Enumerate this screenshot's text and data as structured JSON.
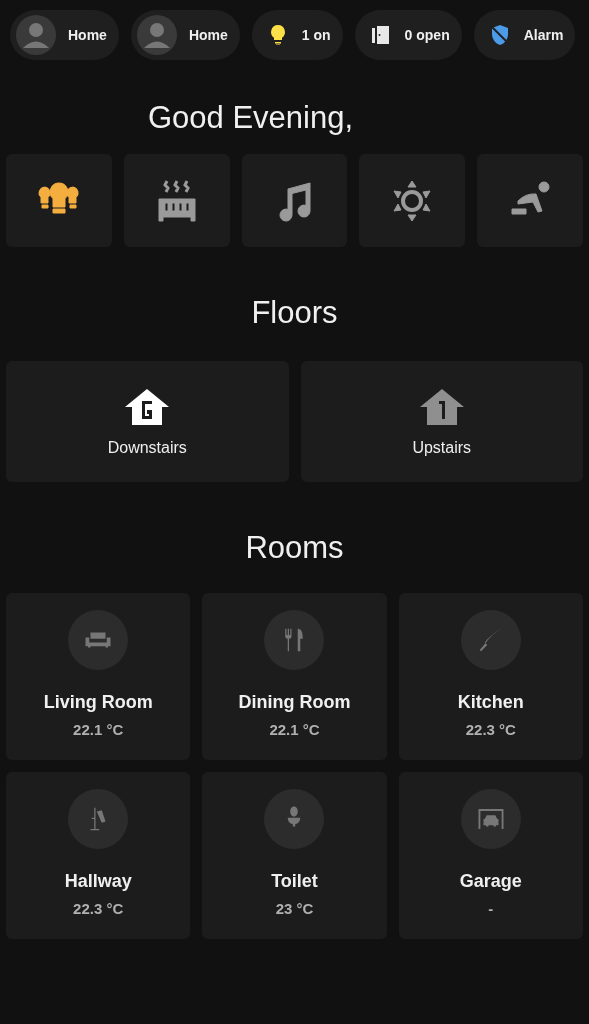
{
  "chips": [
    {
      "kind": "person",
      "label": "Home"
    },
    {
      "kind": "person",
      "label": "Home"
    },
    {
      "kind": "lights",
      "label": "1 on"
    },
    {
      "kind": "doors",
      "label": "0 open"
    },
    {
      "kind": "alarm",
      "label": "Alarm"
    }
  ],
  "greeting": "Good Evening,",
  "quick_actions": [
    {
      "kind": "lights",
      "on": true
    },
    {
      "kind": "heater",
      "on": false
    },
    {
      "kind": "music",
      "on": false
    },
    {
      "kind": "brightness",
      "on": false
    },
    {
      "kind": "vacuum",
      "on": false
    }
  ],
  "floors": {
    "title": "Floors",
    "items": [
      {
        "kind": "ground",
        "label": "Downstairs",
        "active": true
      },
      {
        "kind": "first",
        "label": "Upstairs",
        "active": false
      }
    ]
  },
  "rooms": {
    "title": "Rooms",
    "items": [
      {
        "kind": "sofa",
        "name": "Living Room",
        "temperature": "22.1 °C"
      },
      {
        "kind": "cutlery",
        "name": "Dining Room",
        "temperature": "22.1 °C"
      },
      {
        "kind": "knife",
        "name": "Kitchen",
        "temperature": "22.3 °C"
      },
      {
        "kind": "coat-rack",
        "name": "Hallway",
        "temperature": "22.3 °C"
      },
      {
        "kind": "toilet",
        "name": "Toilet",
        "temperature": "23 °C"
      },
      {
        "kind": "garage",
        "name": "Garage",
        "temperature": "-"
      }
    ]
  }
}
